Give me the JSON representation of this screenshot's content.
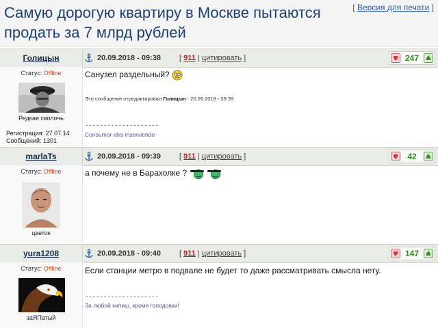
{
  "topic": {
    "title": "Самую дорогую квартиру в Москве пытаются продать за 7 млрд рублей",
    "print_link": "Версия для печати",
    "print_open": "[ ",
    "print_close": " ]"
  },
  "posts": [
    {
      "nick": "Голицын",
      "date": "20.09.2018 - 09:38",
      "num": "911",
      "cite": "цитировать",
      "score": "247",
      "status_label": "Статус: ",
      "status_value": "Offline",
      "avatar_label": "Редкая сволочь",
      "reg": "Регистрация: 27.07.14",
      "msgs": "Сообщений: 1301",
      "text": "Санузел раздельный?",
      "edited_prefix": "Это сообщение отредактировал ",
      "edited_user": "Голицын",
      "edited_suffix": " - 20.09.2018 - 09:39",
      "sig_line": "--------------------",
      "signature": "Consumor aliis inserviendo"
    },
    {
      "nick": "marlaTs",
      "date": "20.09.2018 - 09:39",
      "num": "911",
      "cite": "цитировать",
      "score": "42",
      "status_label": "Статус: ",
      "status_value": "Offline",
      "avatar_label": "цветок",
      "text": "а почему не в Барахолке ?"
    },
    {
      "nick": "yura1208",
      "date": "20.09.2018 - 09:40",
      "num": "911",
      "cite": "цитировать",
      "score": "147",
      "status_label": "Статус: ",
      "status_value": "Offline",
      "avatar_label": "заЯПатый",
      "text": "Если станции метро в подвале не будет то даже рассматривать смысла нету.",
      "sig_line": "--------------------",
      "signature": "За любой кипиш, кроме голодовки!"
    }
  ],
  "colors": {
    "title": "#1f3f73",
    "score_positive": "#2c8a1f",
    "offline": "#d0461f",
    "post_number": "#c4141e"
  },
  "icons": [
    "anchor-icon",
    "vote-down-icon",
    "vote-up-icon",
    "confused-smile-icon",
    "sunglasses-smile-icon"
  ]
}
